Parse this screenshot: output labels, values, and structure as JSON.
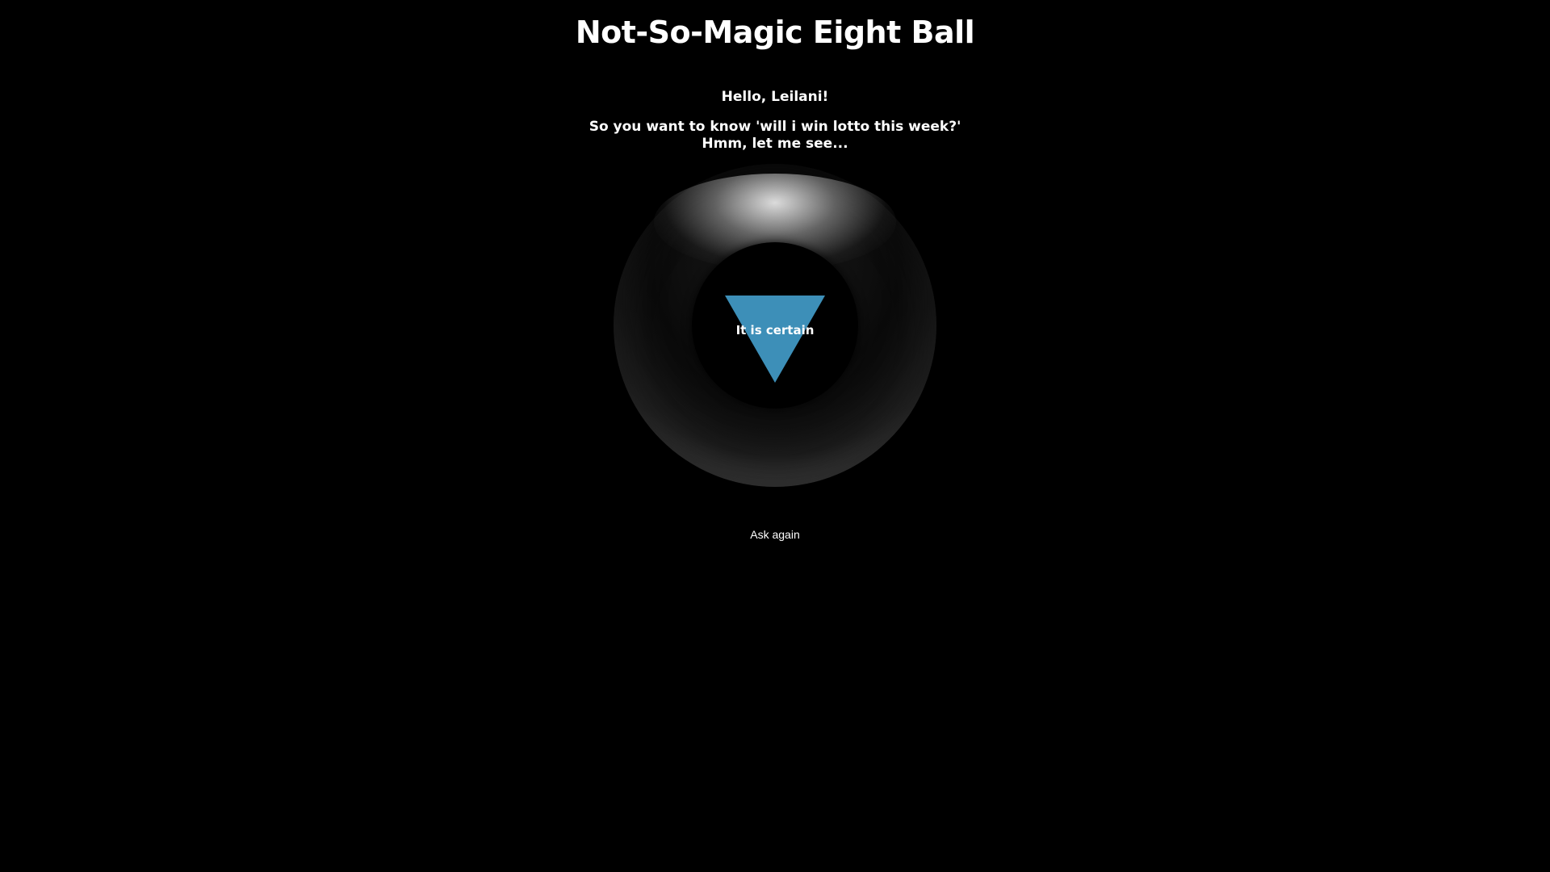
{
  "app": {
    "title": "Not-So-Magic Eight Ball"
  },
  "main": {
    "greeting": "Hello, Leilani!",
    "question_line1": "So you want to know 'will i win lotto this week?'",
    "question_line2": "Hmm, let me see..."
  },
  "ball": {
    "answer": "It is certain",
    "triangle_color": "#3d8fb8"
  },
  "actions": {
    "ask_again_label": "Ask again"
  }
}
